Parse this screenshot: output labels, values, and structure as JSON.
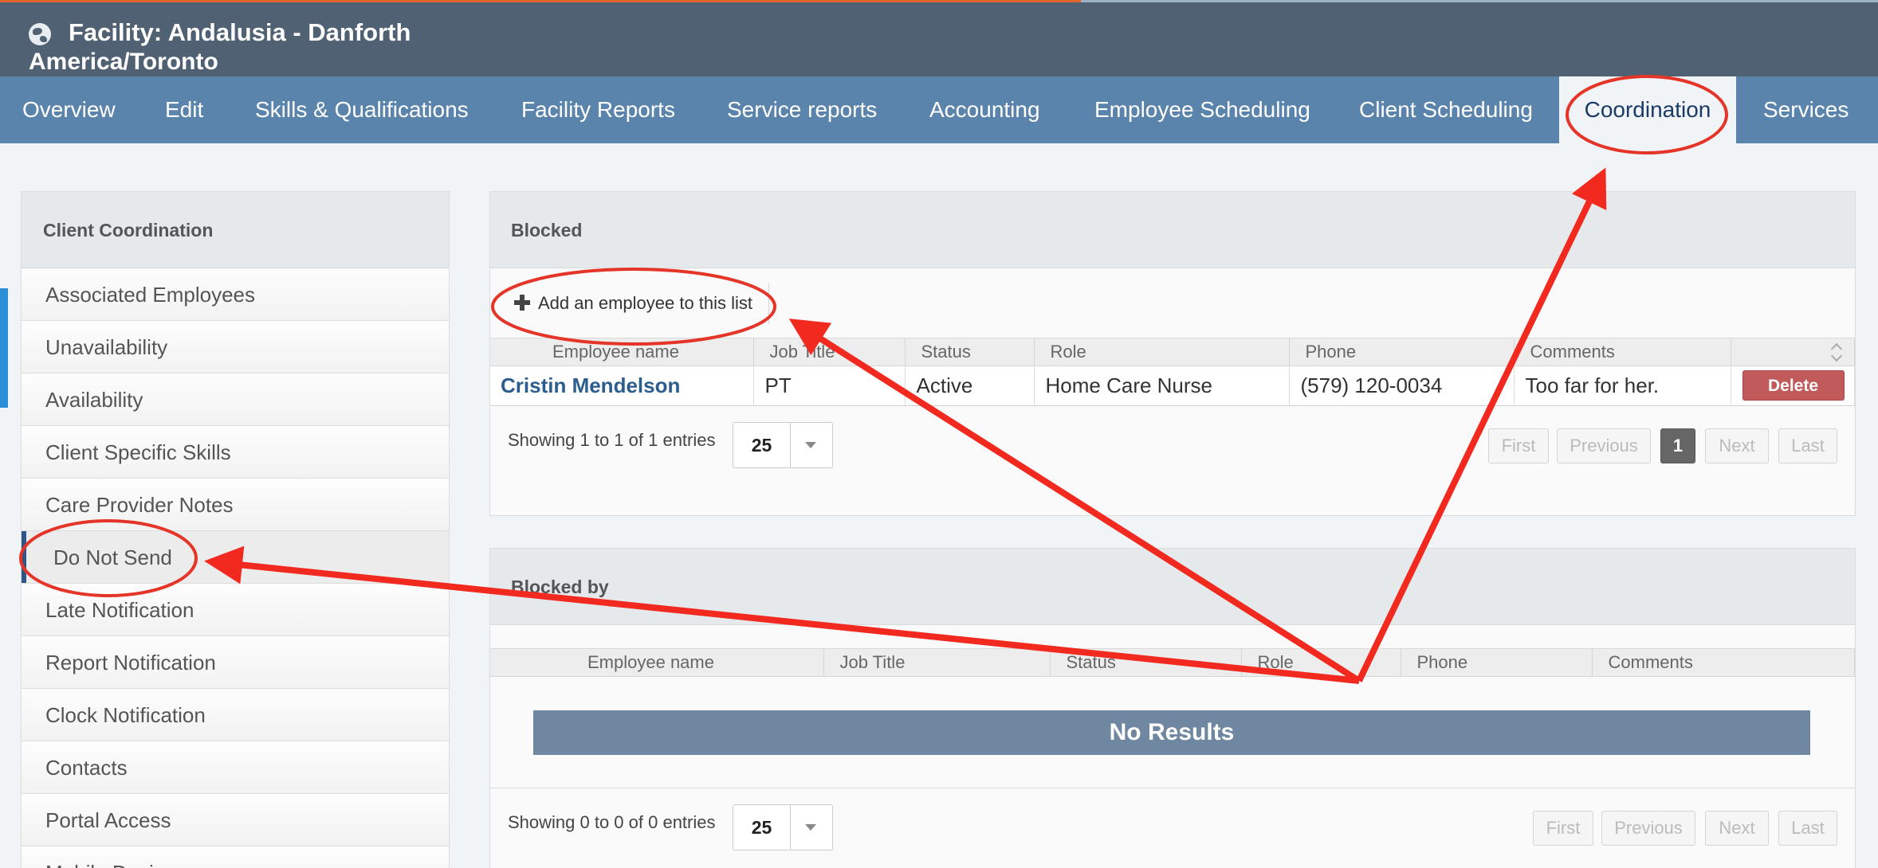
{
  "header": {
    "title_line1": "Facility: Andalusia - Danforth",
    "title_line2": "America/Toronto"
  },
  "nav": {
    "items": [
      "Overview",
      "Edit",
      "Skills & Qualifications",
      "Facility Reports",
      "Service reports",
      "Accounting",
      "Employee Scheduling",
      "Client Scheduling",
      "Coordination",
      "Services"
    ],
    "active": "Coordination"
  },
  "sidebar": {
    "title": "Client Coordination",
    "items": [
      "Associated Employees",
      "Unavailability",
      "Availability",
      "Client Specific Skills",
      "Care Provider Notes",
      "Do Not Send",
      "Late Notification",
      "Report Notification",
      "Clock Notification",
      "Contacts",
      "Portal Access",
      "Mobile Devices"
    ],
    "active": "Do Not Send"
  },
  "blocked": {
    "title": "Blocked",
    "add_label": "Add an employee to this list",
    "columns": [
      "Employee name",
      "Job Title",
      "Status",
      "Role",
      "Phone",
      "Comments"
    ],
    "rows": [
      {
        "name": "Cristin Mendelson",
        "job": "PT",
        "status": "Active",
        "role": "Home Care Nurse",
        "phone": "(579) 120-0034",
        "comments": "Too far for her.",
        "action": "Delete"
      }
    ],
    "showing": "Showing 1 to 1 of 1 entries",
    "page_size": "25",
    "pager": {
      "first": "First",
      "previous": "Previous",
      "current": "1",
      "next": "Next",
      "last": "Last"
    }
  },
  "blocked_by": {
    "title": "Blocked by",
    "columns": [
      "Employee name",
      "Job Title",
      "Status",
      "Role",
      "Phone",
      "Comments"
    ],
    "empty": "No Results",
    "showing": "Showing 0 to 0 of 0 entries",
    "page_size": "25",
    "pager": {
      "first": "First",
      "previous": "Previous",
      "next": "Next",
      "last": "Last"
    }
  },
  "colors": {
    "header": "#4f6172",
    "nav": "#5b84ad",
    "annotation": "#f2291f",
    "delete": "#c05a5b",
    "no_results": "#6f87a0"
  }
}
